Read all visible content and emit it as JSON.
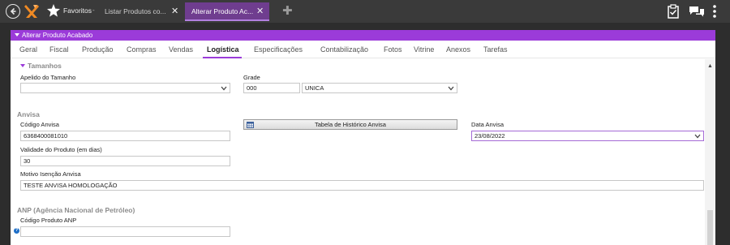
{
  "topbar": {
    "favorites_label": "Favoritos",
    "favorites_caret": "-",
    "tabs": [
      {
        "label": "Listar Produtos co...",
        "active": false
      },
      {
        "label": "Alterar Produto Ac...",
        "active": true
      }
    ],
    "close_glyph": "✕",
    "new_tab_glyph": "✚",
    "icons": [
      "back-icon",
      "logo-icon",
      "star-icon",
      "clipboard-icon",
      "chat-icon",
      "more-vertical-icon"
    ]
  },
  "form": {
    "section_title": "Alterar Produto Acabado",
    "tabs": [
      "Geral",
      "Fiscal",
      "Produção",
      "Compras",
      "Vendas",
      "Logística",
      "Especificações",
      "Contabilização",
      "Fotos",
      "Vitrine",
      "Anexos",
      "Tarefas"
    ],
    "active_tab": "Logística",
    "tamanhos": {
      "heading": "Tamanhos",
      "apelido_label": "Apelido do Tamanho",
      "apelido_value": "",
      "grade_label": "Grade",
      "grade_code": "000",
      "grade_value": "UNICA"
    },
    "anvisa": {
      "heading": "Anvisa",
      "codigo_label": "Código Anvisa",
      "codigo_value": "6368400081010",
      "historico_button": "Tabela de Histórico Anvisa",
      "data_label": "Data Anvisa",
      "data_value": "23/08/2022",
      "validade_label": "Validade do Produto (em dias)",
      "validade_value": "30",
      "motivo_label": "Motivo Isenção Anvisa",
      "motivo_value": "TESTE ANVISA HOMOLOGAÇÃO"
    },
    "anp": {
      "heading": "ANP (Agência Nacional de Petróleo)",
      "codigo_label": "Código Produto ANP",
      "codigo_value": ""
    }
  },
  "colors": {
    "accent": "#9b3bd9",
    "active_tab_bg": "#6f3d8f",
    "topbar_bg": "#3a3a3a",
    "info_blue": "#1e6fc8"
  }
}
